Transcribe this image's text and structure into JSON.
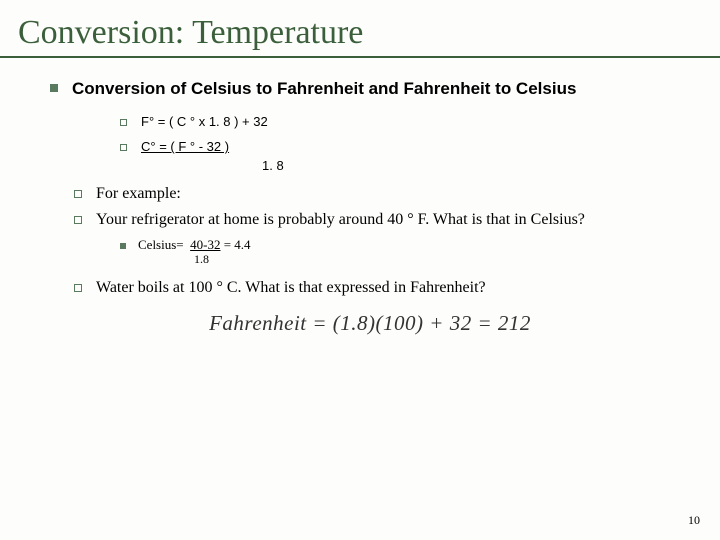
{
  "title": "Conversion: Temperature",
  "heading": "Conversion of Celsius to Fahrenheit and Fahrenheit to Celsius",
  "formula1": "F°   =   ( C °  x   1. 8 )  +   32",
  "formula2_top": "C°   =   ( F  °  -    32    )",
  "formula2_bottom": "1. 8",
  "example_label": "For example:",
  "fridge_q": "Your refrigerator at home is probably around 40 ° F.   What is that in Celsius?",
  "fridge_calc_label": "Celsius=",
  "fridge_calc_frac": "40-32",
  "fridge_calc_result": " = 4.4",
  "fridge_calc_denom": "1.8",
  "boil_q": "Water boils  at 100 ° C.   What is that expressed in Fahrenheit?",
  "fahrenheit_eq": "Fahrenheit = (1.8)(100) + 32 = 212",
  "page_number": "10"
}
